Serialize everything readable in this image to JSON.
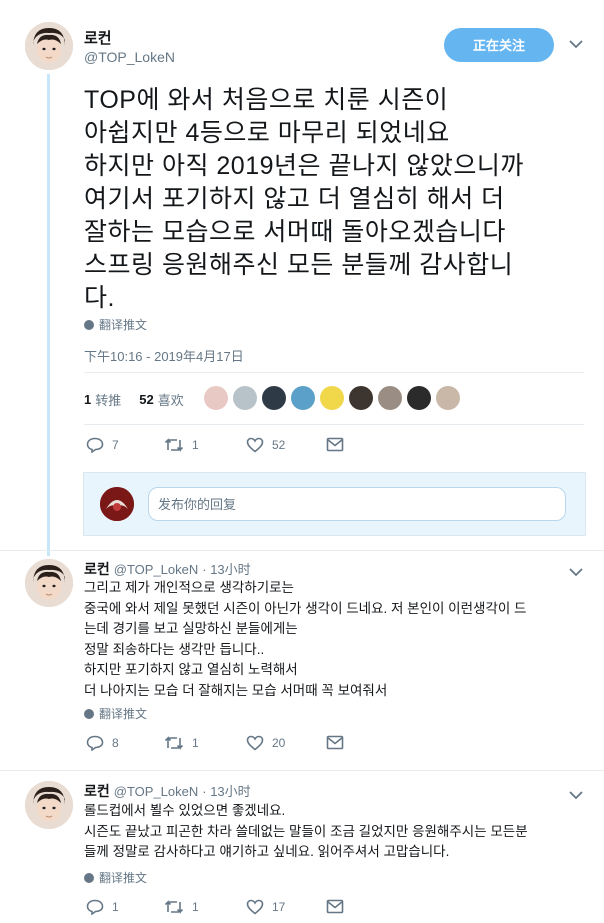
{
  "main_tweet": {
    "name": "로컨",
    "handle": "@TOP_LokeN",
    "follow_label": "正在关注",
    "text_lines": [
      "TOP에 와서 처음으로 치룬 시즌이",
      "아쉽지만 4등으로 마무리 되었네요",
      "하지만 아직 2019년은 끝나지 않았으니까",
      "여기서 포기하지 않고 더 열심히 해서  더",
      "잘하는 모습으로 서머때 돌아오겠습니다",
      "스프링 응원해주신 모든 분들께 감사합니",
      "다."
    ],
    "translate_label": "翻译推文",
    "timestamp": "下午10:16 - 2019年4月17日",
    "retweet_count": "1",
    "retweet_label": "转推",
    "like_count": "52",
    "like_label": "喜欢",
    "actions": {
      "reply": "7",
      "retweet": "1",
      "like": "52"
    }
  },
  "reply_box": {
    "placeholder": "发布你的回复"
  },
  "replies": [
    {
      "name": "로컨",
      "handle": "@TOP_LokeN",
      "time": "· 13小时",
      "lines": [
        "그리고 제가 개인적으로 생각하기로는",
        "중국에 와서 제일 못했던 시즌이 아닌가 생각이 드네요. 저 본인이 이런생각이 드",
        "는데 경기를 보고 실망하신 분들에게는",
        "정말 죄송하다는 생각만 듭니다..",
        "하지만 포기하지 않고 열심히 노력해서",
        "더 나아지는 모습 더 잘해지는 모습 서머때 꼭 보여줘서"
      ],
      "translate_label": "翻译推文",
      "actions": {
        "reply": "8",
        "retweet": "1",
        "like": "20"
      }
    },
    {
      "name": "로컨",
      "handle": "@TOP_LokeN",
      "time": "· 13小时",
      "lines": [
        "롤드컵에서 뵐수 있었으면 좋겠네요.",
        "시즌도 끝났고 피곤한 차라 쓸데없는 말들이 조금 길었지만 응원해주시는 모든분",
        "들께 정말로 감사하다고 얘기하고 싶네요. 읽어주셔서 고맙습니다."
      ],
      "translate_label": "翻译推文",
      "actions": {
        "reply": "1",
        "retweet": "1",
        "like": "17"
      }
    }
  ],
  "colors": {
    "accent": "#1da1f2",
    "follow_bg": "#64b5f0",
    "muted": "#657786",
    "thread_line": "#c8e6fa"
  }
}
